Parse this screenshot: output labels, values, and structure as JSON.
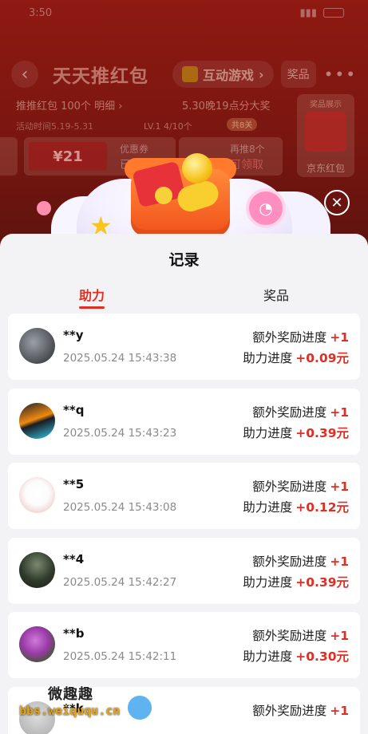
{
  "status_bar": {
    "time": "3:50",
    "battery": "95"
  },
  "nav": {
    "title": "天天推红包",
    "game_label": "互动游戏",
    "prize_label": "奖品",
    "more": "•••"
  },
  "info": {
    "count_line": "推推红包 100个 明细 ›",
    "right_line": "5.30晚19点分大奖",
    "date_line": "活动时间5.19-5.31",
    "level": "LV.1 4/10个",
    "badge": "共8关"
  },
  "coupon": {
    "amount": "¥21",
    "label": "优惠券",
    "status": "已领取"
  },
  "bonus": {
    "text": "再推8个",
    "status": "可领取"
  },
  "side": {
    "top": "奖品展示",
    "bottom": "京东红包"
  },
  "sheet": {
    "title": "记录",
    "tab_help": "助力",
    "tab_prize": "奖品",
    "extra_label": "额外奖励进度",
    "help_label": "助力进度",
    "records": [
      {
        "name": "**y",
        "time": "2025.05.24 15:43:38",
        "extra": "+1",
        "help": "+0.09元"
      },
      {
        "name": "**q",
        "time": "2025.05.24 15:43:23",
        "extra": "+1",
        "help": "+0.39元"
      },
      {
        "name": "**5",
        "time": "2025.05.24 15:43:08",
        "extra": "+1",
        "help": "+0.12元"
      },
      {
        "name": "**4",
        "time": "2025.05.24 15:42:27",
        "extra": "+1",
        "help": "+0.39元"
      },
      {
        "name": "**b",
        "time": "2025.05.24 15:42:11",
        "extra": "+1",
        "help": "+0.30元"
      },
      {
        "name": "**k",
        "time": "",
        "extra": "+1",
        "help": ""
      }
    ]
  },
  "watermark": {
    "top": "微趣趣",
    "bottom": "bbs.weiququ.cn"
  },
  "colors": {
    "accent": "#e02e24",
    "sheet_bg": "#f3f3f5"
  }
}
